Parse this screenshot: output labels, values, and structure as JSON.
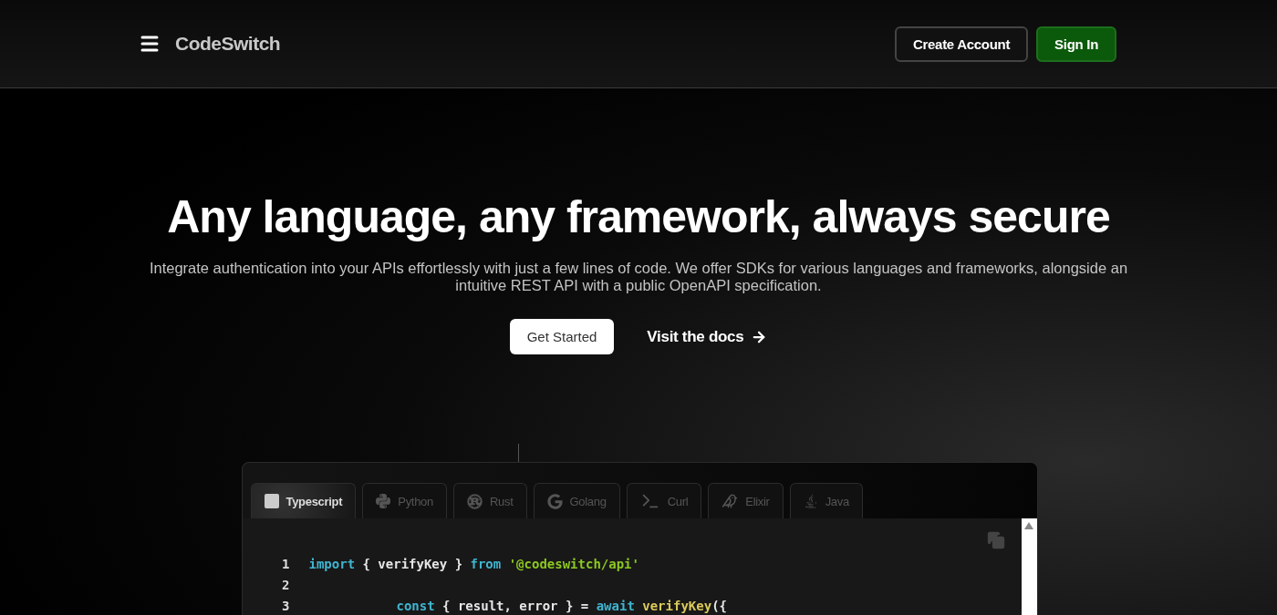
{
  "header": {
    "brand": "CodeSwitch",
    "buttons": [
      {
        "label": "Create Account",
        "kind": "outline"
      },
      {
        "label": "Sign In",
        "kind": "primary"
      }
    ]
  },
  "hero": {
    "title": "Any language, any framework, always secure",
    "subtitle": "Integrate authentication into your APIs effortlessly with just a few lines of code. We offer SDKs for various languages and frameworks, alongside an intuitive REST API with a public OpenAPI specification.",
    "primary_button": "Get Started",
    "docs_link": "Visit the docs"
  },
  "code_panel": {
    "tabs": [
      {
        "label": "Typescript",
        "kind": "js",
        "selected": true
      },
      {
        "label": "Python",
        "kind": "python",
        "selected": false
      },
      {
        "label": "Rust",
        "kind": "rust",
        "selected": false
      },
      {
        "label": "Golang",
        "kind": "go",
        "selected": false
      },
      {
        "label": "Curl",
        "kind": "terminal",
        "selected": false
      },
      {
        "label": "Elixir",
        "kind": "bird",
        "selected": false
      },
      {
        "label": "Java",
        "kind": "java",
        "selected": false
      }
    ],
    "lines": [
      {
        "number": "1",
        "indented": false,
        "tokens": [
          {
            "text": "import",
            "kind": "keyword"
          },
          {
            "text": " { verifyKey } ",
            "kind": "plain"
          },
          {
            "text": "from",
            "kind": "keyword"
          },
          {
            "text": " '@codeswitch/api'",
            "kind": "string"
          }
        ]
      },
      {
        "number": "2"
      },
      {
        "number": "3",
        "indented": true,
        "tokens": [
          {
            "text": "const",
            "kind": "keyword"
          },
          {
            "text": " { result, error } = ",
            "kind": "plain"
          },
          {
            "text": "await",
            "kind": "keyword"
          },
          {
            "text": " verifyKey",
            "kind": "function"
          },
          {
            "text": "({",
            "kind": "plain"
          }
        ]
      }
    ]
  }
}
